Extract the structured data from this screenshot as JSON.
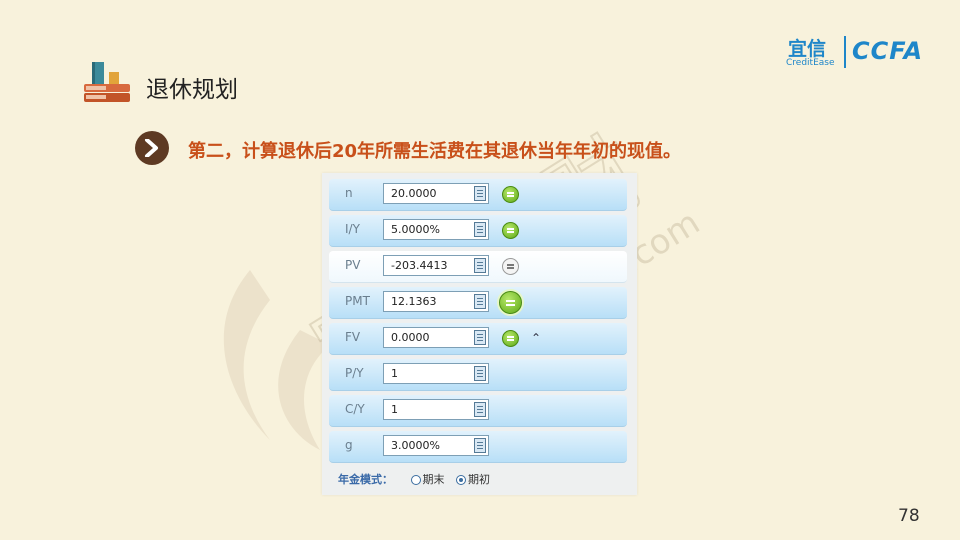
{
  "page_title": "退休规划",
  "logo": {
    "brand_cn": "宜信",
    "brand_en": "CreditEase",
    "brand_ccfa": "CCFA"
  },
  "subtitle": "第二，计算退休后20年所需生活费在其退休当年年初的现值。",
  "watermark": {
    "text_cn": "宜人理财",
    "text_url": "xinghuo.yixin.com"
  },
  "calculator": {
    "rows": [
      {
        "label": "n",
        "value": "20.0000",
        "solve_button": "active"
      },
      {
        "label": "I/Y",
        "value": "5.0000%",
        "solve_button": "active"
      },
      {
        "label": "PV",
        "value": "-203.4413",
        "solve_button": "inactive"
      },
      {
        "label": "PMT",
        "value": "12.1363",
        "solve_button": "active"
      },
      {
        "label": "FV",
        "value": "0.0000",
        "solve_button": "active",
        "extra_icon": "chevron-up-double"
      },
      {
        "label": "P/Y",
        "value": "1"
      },
      {
        "label": "C/Y",
        "value": "1"
      },
      {
        "label": "g",
        "value": "3.0000%"
      }
    ],
    "annuity_mode": {
      "label": "年金模式：",
      "options": [
        "期末",
        "期初"
      ],
      "selected": "期初"
    }
  },
  "page_number": "78",
  "colors": {
    "accent": "#c8501a",
    "brand": "#1e86c9",
    "background": "#f8f2dc"
  }
}
